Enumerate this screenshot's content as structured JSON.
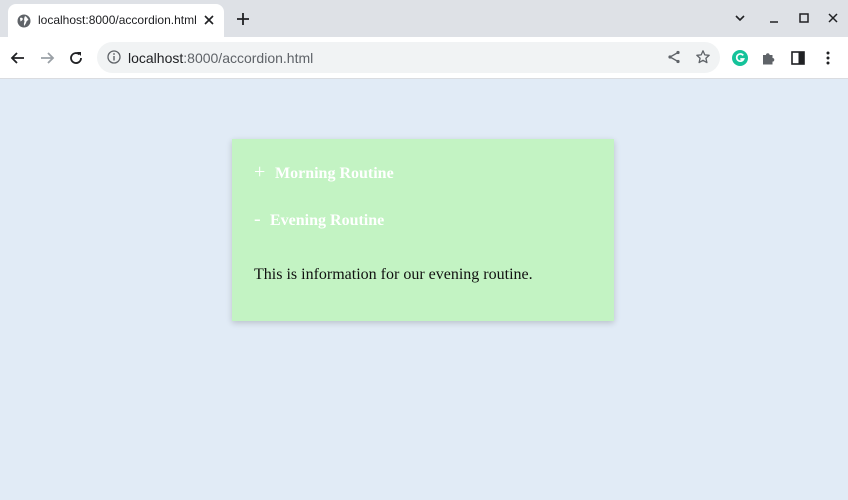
{
  "browser": {
    "tab": {
      "title": "localhost:8000/accordion.html",
      "favicon": "globe-icon"
    },
    "address": {
      "host": "localhost",
      "path": ":8000/accordion.html"
    }
  },
  "colors": {
    "page_background": "#e1ebf6",
    "panel_background": "#c3f3c3",
    "header_text": "#ffffff",
    "grammarly_badge": "#15c39a"
  },
  "accordion": {
    "sections": [
      {
        "symbol": "+",
        "title": "Morning Routine",
        "expanded": false
      },
      {
        "symbol": "-",
        "title": "Evening Routine",
        "expanded": true,
        "content": "This is information for our evening routine."
      }
    ]
  }
}
